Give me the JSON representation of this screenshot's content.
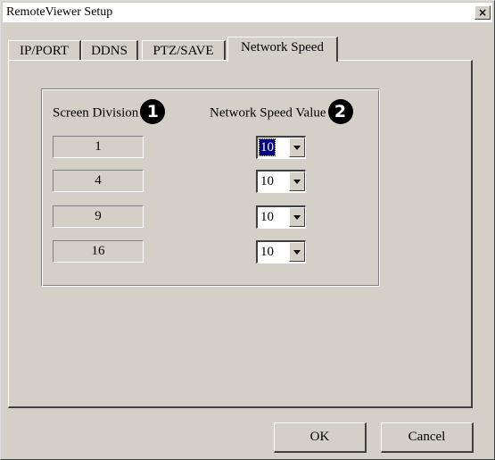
{
  "window": {
    "title": "RemoteViewer Setup",
    "close_label": "×"
  },
  "tabs": [
    {
      "label": "IP/PORT"
    },
    {
      "label": "DDNS"
    },
    {
      "label": "PTZ/SAVE"
    },
    {
      "label": "Network Speed"
    }
  ],
  "group": {
    "screen_division_header": "Screen Division",
    "screen_division_badge": "1",
    "speed_header": "Network Speed Value",
    "speed_badge": "2",
    "rows": [
      {
        "division": "1",
        "speed": "10"
      },
      {
        "division": "4",
        "speed": "10"
      },
      {
        "division": "9",
        "speed": "10"
      },
      {
        "division": "16",
        "speed": "10"
      }
    ]
  },
  "buttons": {
    "ok": "OK",
    "cancel": "Cancel"
  }
}
